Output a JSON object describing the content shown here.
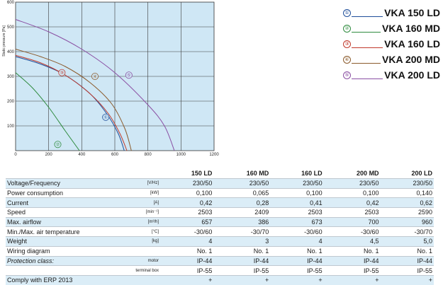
{
  "chart_data": {
    "type": "line",
    "ylabel": "Static pressure [Pa]",
    "xlabel": "Air flow [m³/h]",
    "xlim": [
      0,
      1200
    ],
    "ylim": [
      0,
      600
    ],
    "x_ticks": [
      "0",
      "200",
      "400",
      "600",
      "800",
      "1000",
      "1200"
    ],
    "y_ticks": [
      "100",
      "200",
      "300",
      "400",
      "500",
      "600"
    ],
    "grid": true,
    "background": "#cfe7f5",
    "series": [
      {
        "name": "VKA 150 LD",
        "marker": "①",
        "color": "#1f4e9a",
        "points": [
          [
            0,
            380
          ],
          [
            150,
            350
          ],
          [
            300,
            305
          ],
          [
            450,
            230
          ],
          [
            550,
            150
          ],
          [
            620,
            70
          ],
          [
            657,
            0
          ]
        ],
        "marker_at": [
          545,
          135
        ]
      },
      {
        "name": "VKA 160 MD",
        "marker": "②",
        "color": "#2e8b3e",
        "points": [
          [
            0,
            315
          ],
          [
            100,
            255
          ],
          [
            200,
            175
          ],
          [
            300,
            80
          ],
          [
            386,
            0
          ]
        ],
        "marker_at": [
          255,
          25
        ]
      },
      {
        "name": "VKA 160 LD",
        "marker": "③",
        "color": "#c0392b",
        "points": [
          [
            0,
            385
          ],
          [
            150,
            355
          ],
          [
            300,
            305
          ],
          [
            450,
            230
          ],
          [
            560,
            150
          ],
          [
            630,
            70
          ],
          [
            673,
            0
          ]
        ],
        "marker_at": [
          280,
          315
        ]
      },
      {
        "name": "VKA 200 MD",
        "marker": "④",
        "color": "#8b5a2b",
        "points": [
          [
            0,
            410
          ],
          [
            150,
            380
          ],
          [
            300,
            340
          ],
          [
            450,
            275
          ],
          [
            580,
            190
          ],
          [
            660,
            90
          ],
          [
            700,
            0
          ]
        ],
        "marker_at": [
          480,
          300
        ]
      },
      {
        "name": "VKA 200 LD",
        "marker": "⑤",
        "color": "#8a4fa3",
        "points": [
          [
            0,
            530
          ],
          [
            200,
            480
          ],
          [
            400,
            410
          ],
          [
            600,
            315
          ],
          [
            800,
            185
          ],
          [
            900,
            100
          ],
          [
            960,
            0
          ]
        ],
        "marker_at": [
          685,
          305
        ]
      }
    ]
  },
  "legend": [
    {
      "marker": "①",
      "label": "VKA 150 LD",
      "color": "#1f4e9a"
    },
    {
      "marker": "②",
      "label": "VKA 160 MD",
      "color": "#2e8b3e"
    },
    {
      "marker": "③",
      "label": "VKA 160 LD",
      "color": "#c0392b"
    },
    {
      "marker": "④",
      "label": "VKA 200 MD",
      "color": "#8b5a2b"
    },
    {
      "marker": "⑤",
      "label": "VKA 200 LD",
      "color": "#8a4fa3"
    }
  ],
  "table": {
    "columns": [
      "150 LD",
      "160 MD",
      "160 LD",
      "200 MD",
      "200 LD"
    ],
    "rows": [
      {
        "param": "Voltage/Frequency",
        "unit": "[V/Hz]",
        "values": [
          "230/50",
          "230/50",
          "230/50",
          "230/50",
          "230/50"
        ]
      },
      {
        "param": "Power consumption",
        "unit": "[kW]",
        "values": [
          "0,100",
          "0,065",
          "0,100",
          "0,100",
          "0,140"
        ]
      },
      {
        "param": "Current",
        "unit": "[A]",
        "values": [
          "0,42",
          "0,28",
          "0,41",
          "0,42",
          "0,62"
        ]
      },
      {
        "param": "Speed",
        "unit": "[min⁻¹]",
        "values": [
          "2503",
          "2409",
          "2503",
          "2503",
          "2590"
        ]
      },
      {
        "param": "Max. airflow",
        "unit": "[m³/h]",
        "values": [
          "657",
          "386",
          "673",
          "700",
          "960"
        ]
      },
      {
        "param": "Min./Max. air temperature",
        "unit": "[°C]",
        "values": [
          "-30/60",
          "-30/70",
          "-30/60",
          "-30/60",
          "-30/70"
        ]
      },
      {
        "param": "Weight",
        "unit": "[kg]",
        "values": [
          "4",
          "3",
          "4",
          "4,5",
          "5,0"
        ]
      },
      {
        "param": "Wiring diagram",
        "unit": "",
        "values": [
          "No. 1",
          "No. 1",
          "No. 1",
          "No. 1",
          "No. 1"
        ]
      },
      {
        "param": "Protection class:",
        "unit": "motor",
        "values": [
          "IP-44",
          "IP-44",
          "IP-44",
          "IP-44",
          "IP-44"
        ],
        "italic": true
      },
      {
        "param": "",
        "unit": "terminal box",
        "values": [
          "IP-55",
          "IP-55",
          "IP-55",
          "IP-55",
          "IP-55"
        ]
      },
      {
        "param": "Comply with ERP 2013",
        "unit": "",
        "values": [
          "+",
          "+",
          "+",
          "+",
          "+"
        ]
      }
    ]
  }
}
